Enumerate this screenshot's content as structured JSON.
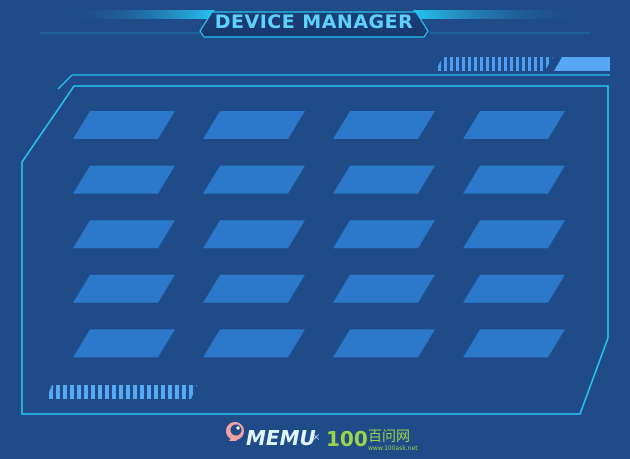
{
  "header": {
    "title": "DEVICE MANAGER"
  },
  "colors": {
    "background": "#1f4b88",
    "frame_stroke": "#27c6f2",
    "slot_fill": "#2c79cb",
    "title_color": "#5fd1ff",
    "stripe_color": "#56a8f5",
    "partner_green": "#9bd44a"
  },
  "grid": {
    "rows": 5,
    "columns": 4
  },
  "footer": {
    "brand": "MEMU",
    "brand_icon": "memu-logo-icon",
    "separator": "×",
    "partner_number": "100",
    "partner_name": "百问网",
    "partner_url": "www.100ask.net"
  }
}
